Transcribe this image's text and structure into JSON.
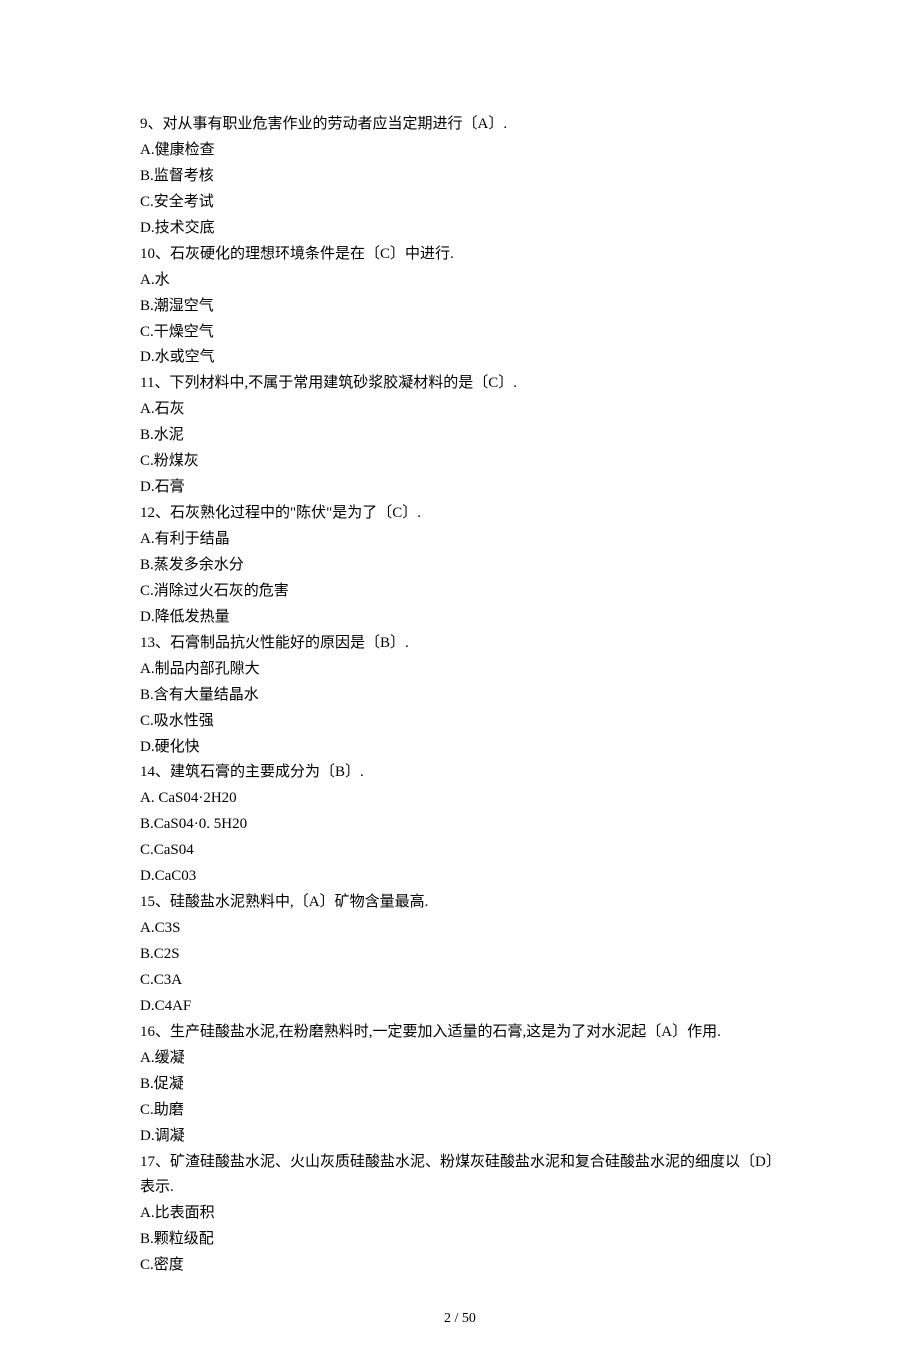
{
  "lines": [
    "9、对从事有职业危害作业的劳动者应当定期进行〔A〕.",
    "A.健康检查",
    "B.监督考核",
    "C.安全考试",
    "D.技术交底",
    "10、石灰硬化的理想环境条件是在〔C〕中进行.",
    "A.水",
    "B.潮湿空气",
    "C.干燥空气",
    "D.水或空气",
    "11、下列材料中,不属于常用建筑砂浆胶凝材料的是〔C〕.",
    "A.石灰",
    "B.水泥",
    "C.粉煤灰",
    "D.石膏",
    "12、石灰熟化过程中的\"陈伏\"是为了〔C〕.",
    "A.有利于结晶",
    "B.蒸发多余水分",
    "C.消除过火石灰的危害",
    "D.降低发热量",
    "13、石膏制品抗火性能好的原因是〔B〕.",
    "A.制品内部孔隙大",
    "B.含有大量结晶水",
    "C.吸水性强",
    "D.硬化快",
    "14、建筑石膏的主要成分为〔B〕.",
    "A. CaS04·2H20",
    "B.CaS04·0. 5H20",
    "C.CaS04",
    "D.CaC03",
    "15、硅酸盐水泥熟料中,〔A〕矿物含量最高.",
    "A.C3S",
    "B.C2S",
    "C.C3A",
    "D.C4AF",
    "16、生产硅酸盐水泥,在粉磨熟料时,一定要加入适量的石膏,这是为了对水泥起〔A〕作用.",
    "A.缓凝",
    "B.促凝",
    "C.助磨",
    "D.调凝",
    "17、矿渣硅酸盐水泥、火山灰质硅酸盐水泥、粉煤灰硅酸盐水泥和复合硅酸盐水泥的细度以〔D〕表示.",
    "A.比表面积",
    "B.颗粒级配",
    "C.密度"
  ],
  "footer": "2 / 50"
}
